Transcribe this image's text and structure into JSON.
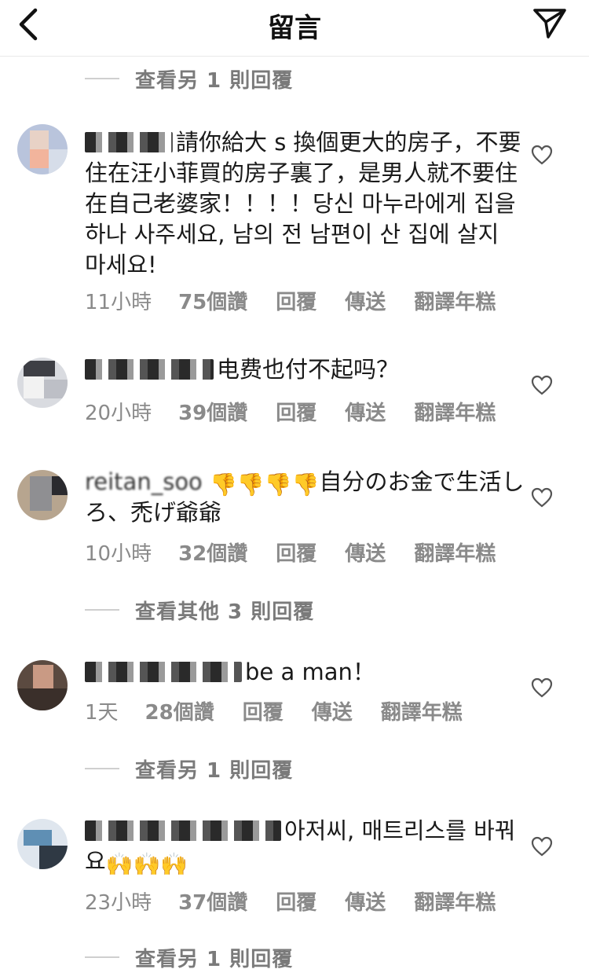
{
  "header": {
    "title": "留言"
  },
  "view_more": [
    {
      "text": "查看另 1 則回覆"
    },
    {
      "text": "查看其他 3 則回覆"
    },
    {
      "text": "查看另 1 則回覆"
    },
    {
      "text": "查看另 1 則回覆"
    }
  ],
  "comments": [
    {
      "text": "請你給大 s 換個更大的房子，不要住在汪小菲買的房子裏了，是男人就不要住在自己老婆家！！！！당신 마누라에게 집을 하나 사주세요, 남의 전 남편이 산 집에 살지 마세요!",
      "time": "11小時",
      "likes": "75個讚",
      "reply": "回覆",
      "send": "傳送",
      "translate": "翻譯年糕"
    },
    {
      "text": "电费也付不起吗？",
      "time": "20小時",
      "likes": "39個讚",
      "reply": "回覆",
      "send": "傳送",
      "translate": "翻譯年糕"
    },
    {
      "text_before": "reitan_soo",
      "emoji": "👎👎👎👎",
      "text": "自分のお金で生活しろ、禿げ爺爺",
      "time": "10小時",
      "likes": "32個讚",
      "reply": "回覆",
      "send": "傳送",
      "translate": "翻譯年糕"
    },
    {
      "text": "be a man！",
      "time": "1天",
      "likes": "28個讚",
      "reply": "回覆",
      "send": "傳送",
      "translate": "翻譯年糕"
    },
    {
      "text": "아저씨, 매트리스를 바꿔요",
      "emoji": "🙌🙌🙌",
      "time": "23小時",
      "likes": "37個讚",
      "reply": "回覆",
      "send": "傳送",
      "translate": "翻譯年糕"
    }
  ],
  "colors": {
    "text": "#1a1a1a",
    "meta": "#8a8a8a",
    "divider": "#cfcfcf",
    "emoji_thumb": "#f4a21c",
    "emoji_hands": "#f6b91c"
  },
  "icons": {
    "back": "chevron-left-icon",
    "send": "paper-plane-icon",
    "like": "heart-outline-icon"
  }
}
